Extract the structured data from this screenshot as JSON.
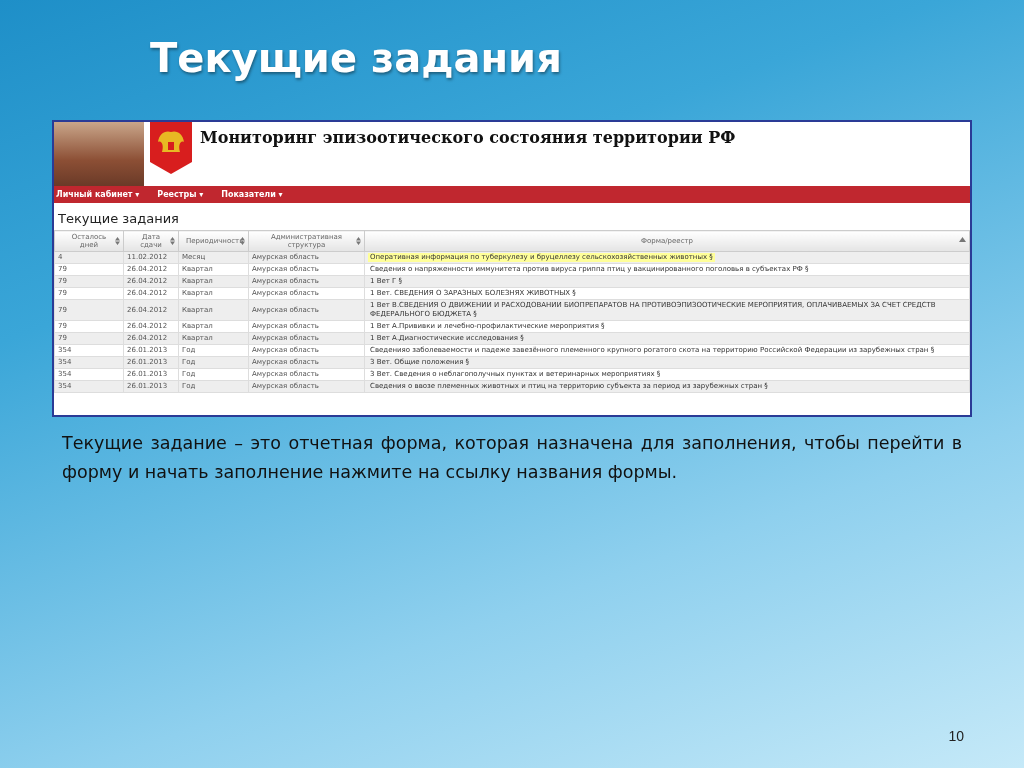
{
  "slide_title": "Текущие задания",
  "app": {
    "site_title": "Мониторинг эпизоотического состояния территории РФ",
    "menu": [
      {
        "label": "Личный кабинет",
        "caret": "▾"
      },
      {
        "label": "Реестры",
        "caret": "▾"
      },
      {
        "label": "Показатели",
        "caret": "▾"
      }
    ],
    "page_title": "Текущие задания",
    "table": {
      "columns": [
        {
          "label": "Осталось дней",
          "sorted": false
        },
        {
          "label": "Дата сдачи",
          "sorted": false
        },
        {
          "label": "Периодичность",
          "sorted": false
        },
        {
          "label": "Административная структура",
          "sorted": false
        },
        {
          "label": "Форма/реестр",
          "sorted": true
        }
      ],
      "rows": [
        {
          "days": "4",
          "date": "11.02.2012",
          "period": "Месяц",
          "region": "Амурская область",
          "form": "Оперативная информация по туберкулезу и бруцеллезу сельскохозяйственных животных §",
          "selected": true
        },
        {
          "days": "79",
          "date": "26.04.2012",
          "period": "Квартал",
          "region": "Амурская область",
          "form": "Сведения о напряженности иммунитета против вируса гриппа птиц у вакцинированного поголовья в субъектах РФ §",
          "selected": false
        },
        {
          "days": "79",
          "date": "26.04.2012",
          "period": "Квартал",
          "region": "Амурская область",
          "form": "1 Вет Г §",
          "selected": false
        },
        {
          "days": "79",
          "date": "26.04.2012",
          "period": "Квартал",
          "region": "Амурская область",
          "form": "1 Вет. СВЕДЕНИЯ О ЗАРАЗНЫХ БОЛЕЗНЯХ ЖИВОТНЫХ §",
          "selected": false
        },
        {
          "days": "79",
          "date": "26.04.2012",
          "period": "Квартал",
          "region": "Амурская область",
          "form": "1 Вет В.СВЕДЕНИЯ О ДВИЖЕНИИ И РАСХОДОВАНИИ БИОПРЕПАРАТОВ НА ПРОТИВОЭПИЗООТИЧЕСКИЕ МЕРОПРИЯТИЯ, ОПЛАЧИВАЕМЫХ ЗА СЧЕТ СРЕДСТВ ФЕДЕРАЛЬНОГО БЮДЖЕТА §",
          "selected": false
        },
        {
          "days": "79",
          "date": "26.04.2012",
          "period": "Квартал",
          "region": "Амурская область",
          "form": "1 Вет А.Прививки и лечебно-профилактические мероприятия §",
          "selected": false
        },
        {
          "days": "79",
          "date": "26.04.2012",
          "period": "Квартал",
          "region": "Амурская область",
          "form": "1 Вет А.Диагностические исследования §",
          "selected": false
        },
        {
          "days": "354",
          "date": "26.01.2013",
          "period": "Год",
          "region": "Амурская область",
          "form": "Сведенияо заболеваемости и падеже завезённого племенного крупного рогатого скота на территорию Российской Федерации из зарубежных стран §",
          "selected": false
        },
        {
          "days": "354",
          "date": "26.01.2013",
          "period": "Год",
          "region": "Амурская область",
          "form": "3 Вет. Общие положения §",
          "selected": false
        },
        {
          "days": "354",
          "date": "26.01.2013",
          "period": "Год",
          "region": "Амурская область",
          "form": "3 Вет. Сведения о неблагополучных пунктах и ветеринарных мероприятиях §",
          "selected": false
        },
        {
          "days": "354",
          "date": "26.01.2013",
          "period": "Год",
          "region": "Амурская область",
          "form": "Сведения о ввозе племенных животных и птиц на территорию субъекта за период из зарубежных стран §",
          "selected": false
        }
      ]
    }
  },
  "description": "Текущие задание – это отчетная форма, которая назначена для заполнения, чтобы перейти в форму и начать заполнение нажмите на ссылку названия формы.",
  "page_number": "10"
}
